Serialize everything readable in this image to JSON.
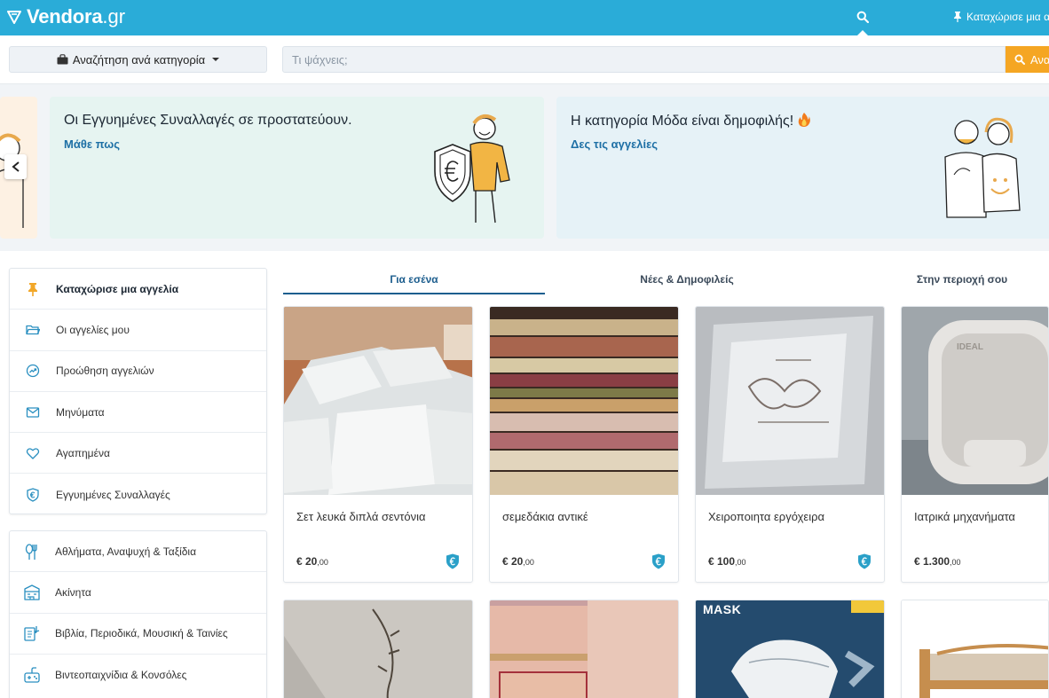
{
  "header": {
    "logo_main": "Vendora",
    "logo_tld": ".gr",
    "post_ad_label": "Καταχώρισε μια α"
  },
  "search": {
    "category_button_label": "Αναζήτηση ανά κατηγορία",
    "placeholder": "Τι ψάχνεις;",
    "button_label": "Ανα"
  },
  "banners": [
    {
      "title": "Οι Εγγυημένες Συναλλαγές σε προστατεύουν.",
      "link": "Μάθε πως"
    },
    {
      "title": "Η κατηγορία Μόδα είναι δημοφιλής!",
      "link": "Δες τις αγγελίες"
    }
  ],
  "sidebar": {
    "account_items": [
      {
        "label": "Καταχώρισε μια αγγελία",
        "icon": "pin-icon"
      },
      {
        "label": "Οι αγγελίες μου",
        "icon": "folder-icon"
      },
      {
        "label": "Προώθηση αγγελιών",
        "icon": "trending-icon"
      },
      {
        "label": "Μηνύματα",
        "icon": "mail-icon"
      },
      {
        "label": "Αγαπημένα",
        "icon": "heart-icon"
      },
      {
        "label": "Εγγυημένες Συναλλαγές",
        "icon": "euro-shield-icon"
      }
    ],
    "categories": [
      {
        "label": "Αθλήματα, Αναψυχή & Ταξίδια",
        "icon": "sports-icon"
      },
      {
        "label": "Ακίνητα",
        "icon": "building-icon"
      },
      {
        "label": "Βιβλία, Περιοδικά, Μουσική & Ταινίες",
        "icon": "books-icon"
      },
      {
        "label": "Βιντεοπαιχνίδια & Κονσόλες",
        "icon": "gamepad-icon"
      }
    ]
  },
  "tabs": [
    {
      "label": "Για εσένα",
      "active": true
    },
    {
      "label": "Νέες & Δημοφιλείς",
      "active": false
    },
    {
      "label": "Στην περιοχή σου",
      "active": false
    }
  ],
  "products": [
    {
      "title": "Σετ λευκά διπλά σεντόνια",
      "price": "€ 20",
      "cents": ",00",
      "guaranteed": true
    },
    {
      "title": "σεμεδάκια αντικέ",
      "price": "€ 20",
      "cents": ",00",
      "guaranteed": true
    },
    {
      "title": "Χειροποιητα εργόχειρα",
      "price": "€ 100",
      "cents": ",00",
      "guaranteed": true
    },
    {
      "title": "Ιατρικά μηχανήματα",
      "price": "€ 1.300",
      "cents": ",00",
      "guaranteed": false
    }
  ],
  "product_image_text": {
    "mask_brand": "MASK",
    "device_brand": "IDEAL"
  },
  "colors": {
    "header_bg": "#2aacd8",
    "search_button": "#f5a623",
    "active_tab": "#1d5e8e",
    "link": "#1d6fa5",
    "guarantee_shield": "#2aa0c8"
  }
}
